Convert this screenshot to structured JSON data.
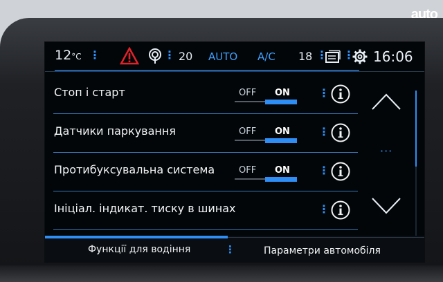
{
  "watermark": "auto",
  "status": {
    "temp_value": "12",
    "temp_unit": "°C",
    "menu_dots": "⋮",
    "fan_level": "20",
    "auto_label": "AUTO",
    "ac_label": "A/C",
    "right_temp": "18",
    "time": "16:06"
  },
  "rows": [
    {
      "label": "Стоп і старт",
      "off": "OFF",
      "on": "ON",
      "state": "ON"
    },
    {
      "label": "Датчики паркування",
      "off": "OFF",
      "on": "ON",
      "state": "ON"
    },
    {
      "label": "Протибуксувальна система",
      "off": "OFF",
      "on": "ON",
      "state": "ON"
    },
    {
      "label": "Ініціал. індикат. тиску в шинах"
    }
  ],
  "row_menu": "⋮",
  "scroll_dots": "···",
  "tabs": {
    "driver_functions": "Функції для водіння",
    "separator": "⋮",
    "vehicle_params": "Параметри автомобіля"
  },
  "colors": {
    "accent": "#2f8ef5",
    "screen_bg": "#030608",
    "warning": "#e2222a"
  }
}
